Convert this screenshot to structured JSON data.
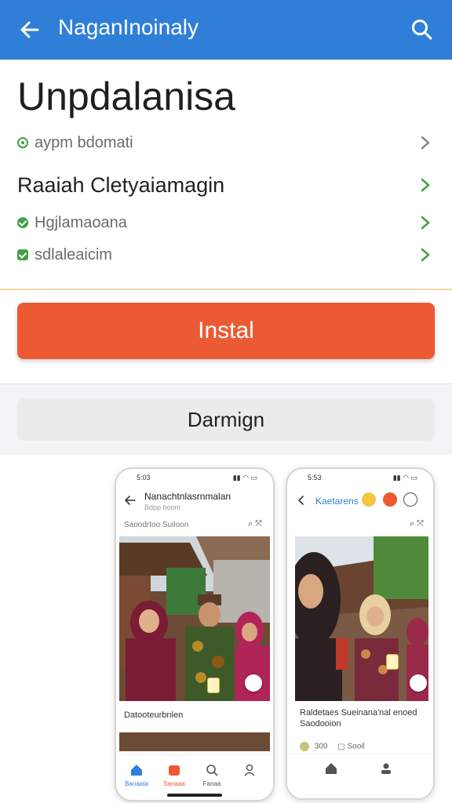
{
  "appbar": {
    "title": "NaganInoinaly",
    "back_icon": "arrow-left-icon",
    "search_icon": "search-icon",
    "color": "#2f7fd8"
  },
  "app": {
    "name": "Unpdalanisa",
    "meta": "aypm bdomati",
    "developer": "Raaiah Cletyaiamagin",
    "row1": "Hgjlamaoana",
    "row2": "sdlaleaicim"
  },
  "install": {
    "label": "Instal",
    "color": "#ec5a33"
  },
  "section": {
    "title": "Darmign"
  },
  "phone1": {
    "time": "5:03",
    "title": "Nanachtnlasrnmalan",
    "subtitle": "Bdpp boom",
    "section": "Saoodrtoo Suiloon",
    "caption": "Datooteurbnlen",
    "tabs": [
      "Baoaata",
      "Sanaaa",
      "Fanaa",
      ""
    ]
  },
  "phone2": {
    "time": "5:53",
    "title": "Kaetarens",
    "caption": "Raldetaes Sueinana'nal enoed Saodooion",
    "likes": "300",
    "label": "Sooil"
  }
}
